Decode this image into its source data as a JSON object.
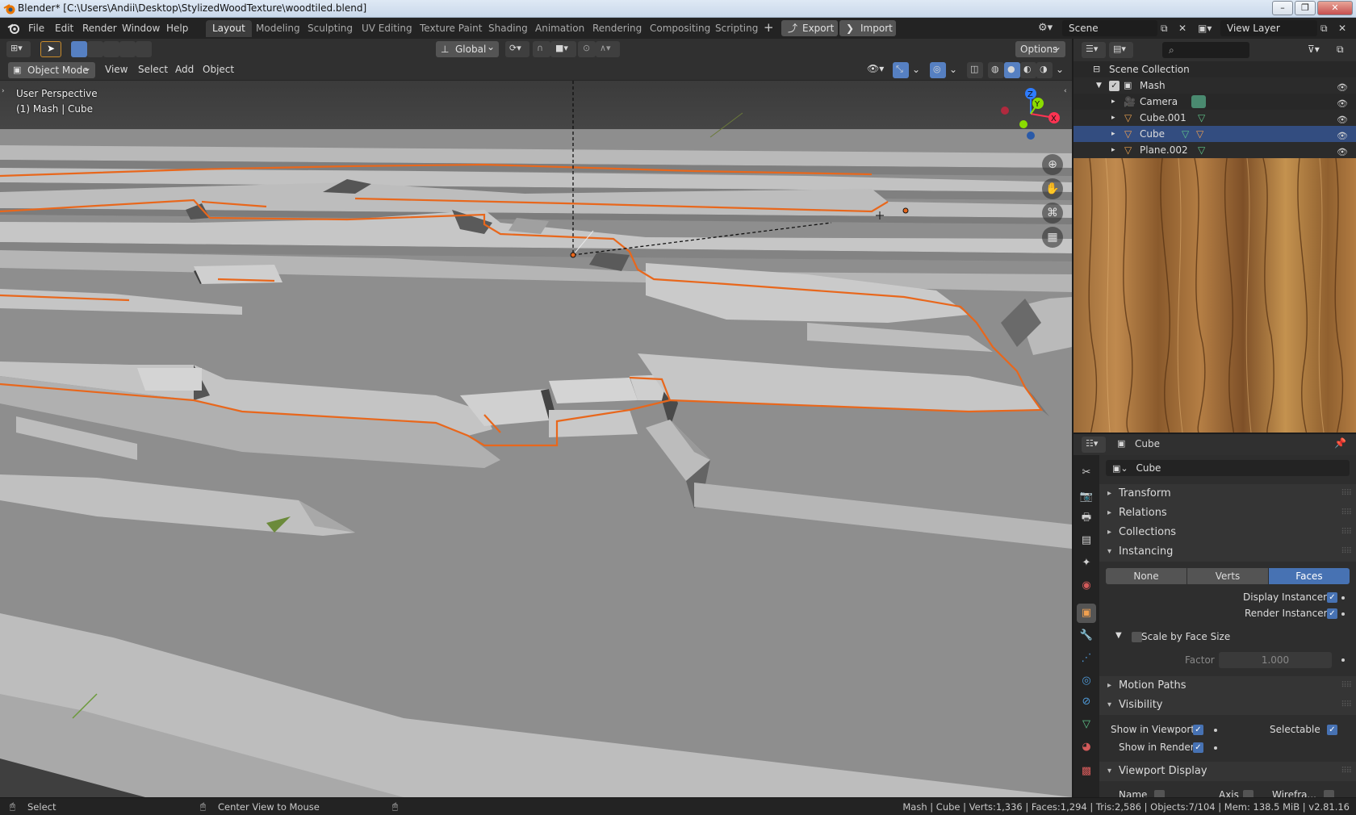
{
  "window": {
    "title": "Blender* [C:\\Users\\Andii\\Desktop\\StylizedWoodTexture\\woodtiled.blend]",
    "buttons": [
      "–",
      "❐",
      "✕"
    ]
  },
  "menu": {
    "items": [
      "File",
      "Edit",
      "Render",
      "Window",
      "Help"
    ]
  },
  "workspaces": {
    "tabs": [
      "Layout",
      "Modeling",
      "Sculpting",
      "UV Editing",
      "Texture Paint",
      "Shading",
      "Animation",
      "Rendering",
      "Compositing",
      "Scripting"
    ],
    "add": "+",
    "export": "Export",
    "import": "Import"
  },
  "scene": {
    "name": "Scene",
    "view_layer": "View Layer"
  },
  "viewport": {
    "mode": "Object Mode",
    "menus": [
      "View",
      "Select",
      "Add",
      "Object"
    ],
    "orientation": "Global",
    "options": "Options",
    "overlay_line1": "User Perspective",
    "overlay_line2": "(1) Mash | Cube",
    "gizmo": {
      "x": "X",
      "y": "Y",
      "z": "Z"
    }
  },
  "outliner": {
    "root": "Scene Collection",
    "items": [
      {
        "name": "Mash",
        "icon": "collection-icon"
      },
      {
        "name": "Camera",
        "icon": "camera-icon"
      },
      {
        "name": "Cube.001",
        "icon": "mesh-icon"
      },
      {
        "name": "Cube",
        "icon": "mesh-icon"
      },
      {
        "name": "Plane.002",
        "icon": "mesh-icon"
      }
    ]
  },
  "properties": {
    "object_name": "Cube",
    "object_field": "Cube",
    "panels": {
      "transform": "Transform",
      "relations": "Relations",
      "collections": "Collections",
      "instancing": "Instancing",
      "motion_paths": "Motion Paths",
      "visibility": "Visibility",
      "viewport_display": "Viewport Display"
    },
    "instancing": {
      "options": [
        "None",
        "Verts",
        "Faces"
      ],
      "selected": "Faces",
      "display_instancer": "Display Instancer",
      "render_instancer": "Render Instancer",
      "scale_by_face_size": "Scale by Face Size",
      "factor_label": "Factor",
      "factor_value": "1.000"
    },
    "visibility": {
      "show_in_viewports": "Show in Viewports",
      "show_in_renders": "Show in Renders",
      "selectable": "Selectable"
    },
    "viewport_display": {
      "name": "Name",
      "axis": "Axis",
      "wireframe": "Wirefra..."
    }
  },
  "statusbar": {
    "left": "Select",
    "middle": "Center View to Mouse",
    "stats": "Mash | Cube | Verts:1,336 | Faces:1,294 | Tris:2,586 | Objects:7/104 | Mem: 138.5 MiB | v2.81.16"
  },
  "colors": {
    "selection_outline": "#e8671c",
    "accent_blue": "#4772b3",
    "viewport_gray": "#8f8f8f"
  }
}
